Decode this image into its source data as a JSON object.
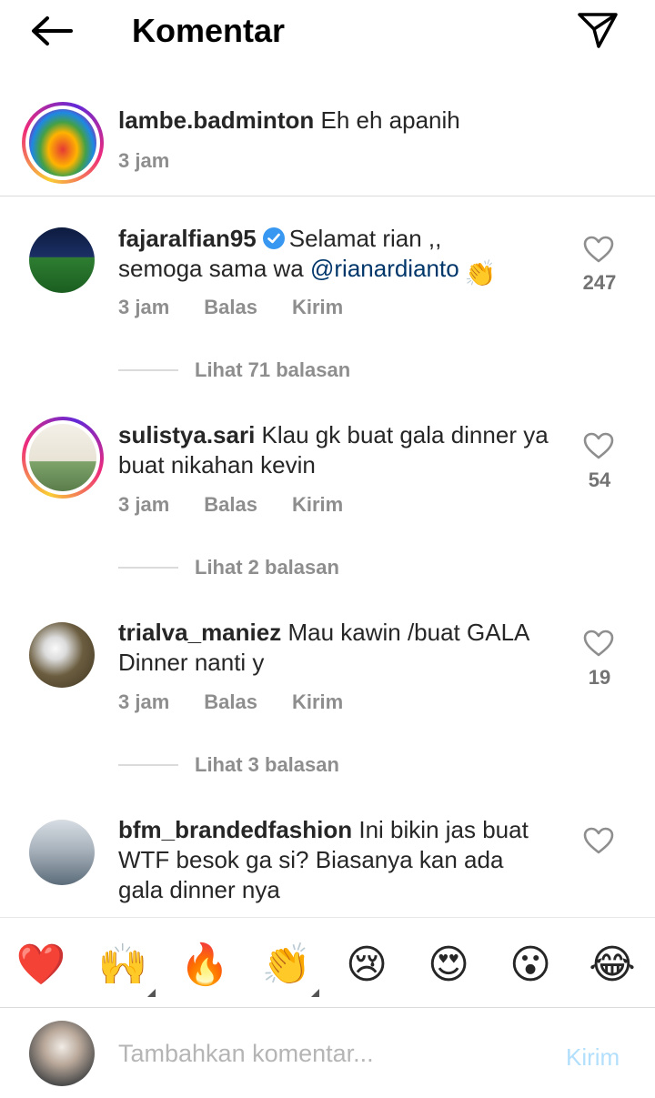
{
  "header": {
    "title": "Komentar"
  },
  "caption": {
    "username": "lambe.badminton",
    "text": "Eh eh apanih",
    "time": "3 jam"
  },
  "comments": [
    {
      "username": "fajaralfian95",
      "verified": true,
      "text_line1": "Selamat rian ,,",
      "text_line2_prefix": "semoga sama wa ",
      "mention": "@rianardianto",
      "emoji": "👏",
      "time": "3 jam",
      "reply": "Balas",
      "send": "Kirim",
      "likes": "247",
      "view_replies": "Lihat 71 balasan"
    },
    {
      "username": "sulistya.sari",
      "text_line1": "Klau gk buat gala dinner ya",
      "text_line2": "buat nikahan kevin",
      "time": "3 jam",
      "reply": "Balas",
      "send": "Kirim",
      "likes": "54",
      "view_replies": "Lihat 2 balasan"
    },
    {
      "username": "trialva_maniez",
      "text_line1": "Mau kawin /buat GALA",
      "text_line2": "Dinner nanti y",
      "time": "3 jam",
      "reply": "Balas",
      "send": "Kirim",
      "likes": "19",
      "view_replies": "Lihat 3 balasan"
    },
    {
      "username": "bfm_brandedfashion",
      "text_line1": "Ini bikin jas buat",
      "text_line2": "WTF besok ga si? Biasanya kan ada",
      "text_line3": "gala dinner nya"
    }
  ],
  "emoji_bar": [
    "❤️",
    "🙌",
    "🔥",
    "👏",
    "😢",
    "😍",
    "😮",
    "😂"
  ],
  "composer": {
    "placeholder": "Tambahkan komentar...",
    "post_label": "Kirim"
  },
  "colors": {
    "link": "#00376b",
    "muted": "#8e8e8e",
    "post_disabled": "#b2dffc",
    "verified": "#3897f0"
  }
}
